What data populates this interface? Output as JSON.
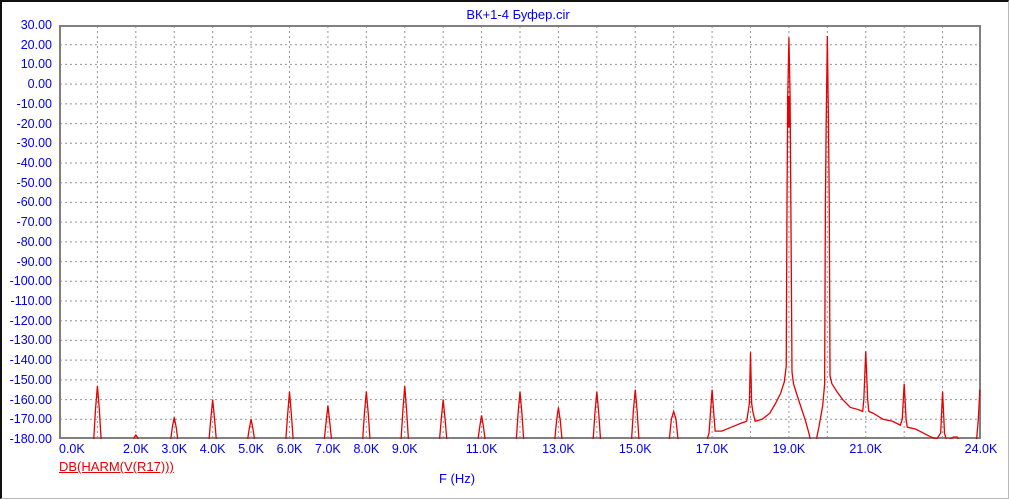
{
  "window": {
    "title": "ВК+1-4 Буфер.cir"
  },
  "chart_data": {
    "type": "line",
    "title": "ВК+1-4 Буфер.cir",
    "xlabel": "F (Hz)",
    "ylabel": "",
    "legend": [
      {
        "label": "DB(HARM(V(R17)))",
        "color": "#e80000"
      }
    ],
    "xlim_khz": [
      0,
      24
    ],
    "ylim_db": [
      -180,
      30
    ],
    "grid": {
      "x_step_khz": 1,
      "y_step_db": 10,
      "style": "dashed",
      "on": true
    },
    "y_tick_labels": [
      "30.00",
      "20.00",
      "10.00",
      "0.00",
      "-10.00",
      "-20.00",
      "-30.00",
      "-40.00",
      "-50.00",
      "-60.00",
      "-70.00",
      "-80.00",
      "-90.00",
      "-100.00",
      "-110.00",
      "-120.00",
      "-130.00",
      "-140.00",
      "-150.00",
      "-160.00",
      "-170.00",
      "-180.00"
    ],
    "y_tick_values": [
      30,
      20,
      10,
      0,
      -10,
      -20,
      -30,
      -40,
      -50,
      -60,
      -70,
      -80,
      -90,
      -100,
      -110,
      -120,
      -130,
      -140,
      -150,
      -160,
      -170,
      -180
    ],
    "x_ticks": [
      {
        "khz": 0,
        "label": "0.0K",
        "align": "left"
      },
      {
        "khz": 2,
        "label": "2.0K",
        "align": "center"
      },
      {
        "khz": 3,
        "label": "3.0K",
        "align": "center"
      },
      {
        "khz": 4,
        "label": "4.0K",
        "align": "center"
      },
      {
        "khz": 5,
        "label": "5.0K",
        "align": "center"
      },
      {
        "khz": 6,
        "label": "6.0K",
        "align": "center"
      },
      {
        "khz": 7,
        "label": "7.0K",
        "align": "center"
      },
      {
        "khz": 8,
        "label": "8.0K",
        "align": "center"
      },
      {
        "khz": 9,
        "label": "9.0K",
        "align": "center"
      },
      {
        "khz": 11,
        "label": "11.0K",
        "align": "center"
      },
      {
        "khz": 13,
        "label": "13.0K",
        "align": "center"
      },
      {
        "khz": 15,
        "label": "15.0K",
        "align": "center"
      },
      {
        "khz": 17,
        "label": "17.0K",
        "align": "center"
      },
      {
        "khz": 19,
        "label": "19.0K",
        "align": "center"
      },
      {
        "khz": 21,
        "label": "21.0K",
        "align": "center"
      },
      {
        "khz": 24,
        "label": "24.0K",
        "align": "center"
      }
    ],
    "harmonics_khz_db": [
      [
        1,
        -153
      ],
      [
        2,
        -178
      ],
      [
        3,
        -169
      ],
      [
        4,
        -160
      ],
      [
        5,
        -170
      ],
      [
        6,
        -156
      ],
      [
        7,
        -163
      ],
      [
        8,
        -156
      ],
      [
        9,
        -153
      ],
      [
        10,
        -160
      ],
      [
        11,
        -168
      ],
      [
        12,
        -156
      ],
      [
        13,
        -164
      ],
      [
        14,
        -156
      ],
      [
        15,
        -155
      ],
      [
        16,
        -166
      ],
      [
        17,
        -155
      ],
      [
        18,
        -136
      ],
      [
        19,
        23.7
      ],
      [
        20,
        24.4
      ],
      [
        21,
        -135.5
      ],
      [
        22,
        -152
      ],
      [
        23,
        -156
      ],
      [
        24,
        -155
      ]
    ],
    "peak_19k_bold_db": [
      -6,
      -22
    ],
    "curve_khz_db": [
      [
        0,
        -181.5
      ],
      [
        0.9,
        -181.5
      ],
      [
        0.95,
        -165
      ],
      [
        1.0,
        -153
      ],
      [
        1.05,
        -165
      ],
      [
        1.1,
        -181.5
      ],
      [
        1.92,
        -181.5
      ],
      [
        1.96,
        -179
      ],
      [
        2.0,
        -178
      ],
      [
        2.04,
        -179
      ],
      [
        2.08,
        -181.5
      ],
      [
        2.9,
        -181.5
      ],
      [
        2.95,
        -174
      ],
      [
        3.0,
        -169
      ],
      [
        3.05,
        -174
      ],
      [
        3.1,
        -181.5
      ],
      [
        3.9,
        -181.5
      ],
      [
        3.95,
        -170
      ],
      [
        4.0,
        -160
      ],
      [
        4.05,
        -170
      ],
      [
        4.1,
        -181.5
      ],
      [
        4.9,
        -181.5
      ],
      [
        4.95,
        -175
      ],
      [
        5.0,
        -170
      ],
      [
        5.05,
        -175
      ],
      [
        5.1,
        -181.5
      ],
      [
        5.9,
        -181.5
      ],
      [
        5.95,
        -168
      ],
      [
        6.0,
        -156
      ],
      [
        6.05,
        -168
      ],
      [
        6.1,
        -181.5
      ],
      [
        6.9,
        -181.5
      ],
      [
        6.95,
        -172
      ],
      [
        7.0,
        -163
      ],
      [
        7.05,
        -172
      ],
      [
        7.1,
        -181.5
      ],
      [
        7.9,
        -181.5
      ],
      [
        7.95,
        -167
      ],
      [
        8.0,
        -156
      ],
      [
        8.05,
        -167
      ],
      [
        8.1,
        -181.5
      ],
      [
        8.9,
        -181.5
      ],
      [
        8.95,
        -166
      ],
      [
        9.0,
        -153
      ],
      [
        9.05,
        -166
      ],
      [
        9.1,
        -181.5
      ],
      [
        9.9,
        -181.5
      ],
      [
        9.95,
        -170
      ],
      [
        10.0,
        -160
      ],
      [
        10.05,
        -170
      ],
      [
        10.1,
        -181.5
      ],
      [
        10.9,
        -181.5
      ],
      [
        10.95,
        -174
      ],
      [
        11.0,
        -168
      ],
      [
        11.05,
        -174
      ],
      [
        11.1,
        -181.5
      ],
      [
        11.9,
        -181.5
      ],
      [
        11.95,
        -167
      ],
      [
        12.0,
        -156
      ],
      [
        12.05,
        -167
      ],
      [
        12.1,
        -181.5
      ],
      [
        12.9,
        -181.5
      ],
      [
        12.95,
        -171
      ],
      [
        13.0,
        -164
      ],
      [
        13.05,
        -171
      ],
      [
        13.1,
        -181.5
      ],
      [
        13.9,
        -181.5
      ],
      [
        13.95,
        -167
      ],
      [
        14.0,
        -156
      ],
      [
        14.05,
        -167
      ],
      [
        14.1,
        -181.5
      ],
      [
        14.9,
        -181.5
      ],
      [
        14.95,
        -166
      ],
      [
        15.0,
        -155
      ],
      [
        15.05,
        -166
      ],
      [
        15.1,
        -181.5
      ],
      [
        15.88,
        -181.5
      ],
      [
        15.94,
        -170
      ],
      [
        16.0,
        -166
      ],
      [
        16.06,
        -170
      ],
      [
        16.12,
        -181.5
      ],
      [
        16.85,
        -181.5
      ],
      [
        16.92,
        -177
      ],
      [
        16.96,
        -166
      ],
      [
        17.0,
        -155
      ],
      [
        17.04,
        -166
      ],
      [
        17.08,
        -176
      ],
      [
        17.25,
        -176
      ],
      [
        17.5,
        -174
      ],
      [
        17.75,
        -172
      ],
      [
        17.9,
        -171
      ],
      [
        17.94,
        -166
      ],
      [
        17.97,
        -162
      ],
      [
        18.0,
        -136
      ],
      [
        18.03,
        -162
      ],
      [
        18.06,
        -166
      ],
      [
        18.12,
        -171
      ],
      [
        18.3,
        -170
      ],
      [
        18.5,
        -167
      ],
      [
        18.65,
        -162
      ],
      [
        18.78,
        -157
      ],
      [
        18.88,
        -151
      ],
      [
        18.93,
        -143
      ],
      [
        18.95,
        -60
      ],
      [
        18.97,
        -6
      ],
      [
        19.0,
        23.7
      ],
      [
        19.03,
        -6
      ],
      [
        19.05,
        -60
      ],
      [
        19.08,
        -146
      ],
      [
        19.12,
        -152
      ],
      [
        19.2,
        -157
      ],
      [
        19.3,
        -163
      ],
      [
        19.42,
        -170
      ],
      [
        19.52,
        -177
      ],
      [
        19.57,
        -181.5
      ],
      [
        19.7,
        -181.5
      ],
      [
        19.78,
        -174
      ],
      [
        19.88,
        -163
      ],
      [
        19.93,
        -152
      ],
      [
        19.95,
        -60
      ],
      [
        19.97,
        -20
      ],
      [
        20.0,
        24.4
      ],
      [
        20.03,
        -20
      ],
      [
        20.05,
        -60
      ],
      [
        20.07,
        -148
      ],
      [
        20.12,
        -152
      ],
      [
        20.25,
        -156
      ],
      [
        20.4,
        -160
      ],
      [
        20.6,
        -164
      ],
      [
        20.8,
        -165
      ],
      [
        20.92,
        -166
      ],
      [
        20.95,
        -160
      ],
      [
        21.0,
        -135.5
      ],
      [
        21.05,
        -160
      ],
      [
        21.08,
        -166
      ],
      [
        21.2,
        -167
      ],
      [
        21.45,
        -170
      ],
      [
        21.7,
        -171
      ],
      [
        21.9,
        -173
      ],
      [
        21.95,
        -170
      ],
      [
        22.0,
        -152
      ],
      [
        22.05,
        -170
      ],
      [
        22.08,
        -174
      ],
      [
        22.3,
        -175
      ],
      [
        22.5,
        -177
      ],
      [
        22.7,
        -179
      ],
      [
        22.85,
        -180
      ],
      [
        22.95,
        -177
      ],
      [
        23.0,
        -156
      ],
      [
        23.05,
        -177
      ],
      [
        23.1,
        -180.5
      ],
      [
        23.2,
        -180
      ],
      [
        23.28,
        -179
      ],
      [
        23.38,
        -179
      ],
      [
        23.45,
        -181.5
      ],
      [
        23.88,
        -181.5
      ],
      [
        23.93,
        -170
      ],
      [
        23.97,
        -155
      ]
    ],
    "colors": {
      "trace": "#e80000",
      "axis_text": "#0000f0",
      "frame": "#808080",
      "grid": "#949494",
      "background": "#ffffff"
    }
  }
}
